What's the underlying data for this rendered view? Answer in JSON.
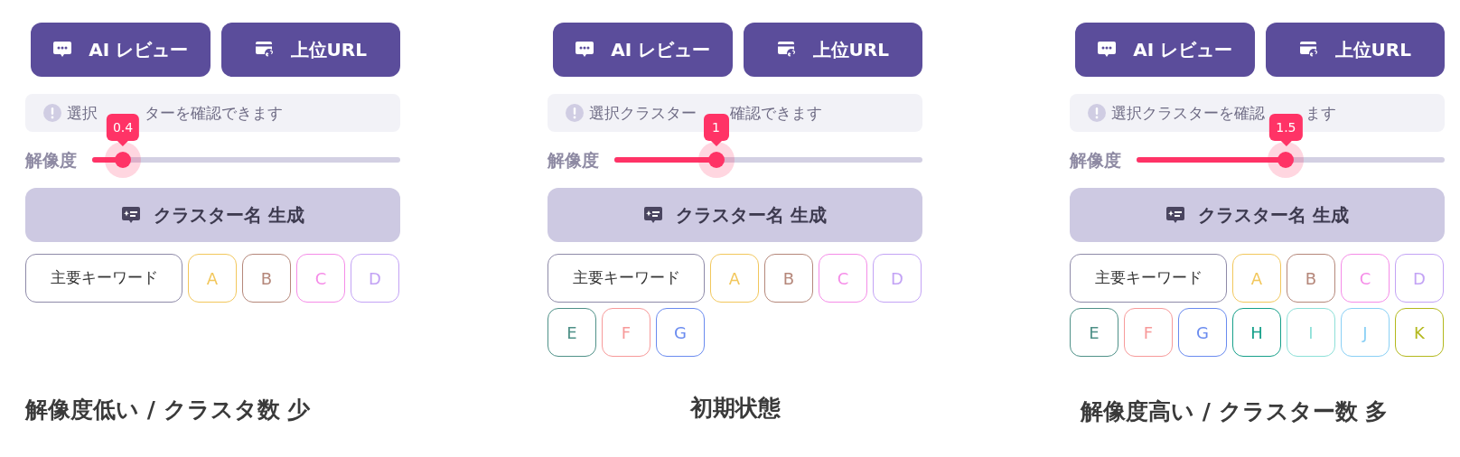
{
  "panels": [
    {
      "buttons": [
        "AI レビュー",
        "上位URL"
      ],
      "hint": [
        "選択",
        "ターを確認できます"
      ],
      "slider": {
        "label": "解像度",
        "value": "0.4",
        "level": 0.1
      },
      "generate_button": "クラスター名 生成",
      "keyword_chip": "主要キーワード",
      "clusters": [
        {
          "label": "A",
          "color": "#f2c75c"
        },
        {
          "label": "B",
          "color": "#b5877a"
        },
        {
          "label": "C",
          "color": "#f58ce8"
        },
        {
          "label": "D",
          "color": "#c3a3f5"
        }
      ],
      "caption": "解像度低い / クラスタ数 少"
    },
    {
      "buttons": [
        "AI レビュー",
        "上位URL"
      ],
      "hint": [
        "選択クラスター",
        "確認できます"
      ],
      "slider": {
        "label": "解像度",
        "value": "1",
        "level": 0.33
      },
      "generate_button": "クラスター名 生成",
      "keyword_chip": "主要キーワード",
      "clusters": [
        {
          "label": "A",
          "color": "#f2c75c"
        },
        {
          "label": "B",
          "color": "#b5877a"
        },
        {
          "label": "C",
          "color": "#f58ce8"
        },
        {
          "label": "D",
          "color": "#c3a3f5"
        },
        {
          "label": "E",
          "color": "#4f9188"
        },
        {
          "label": "F",
          "color": "#f79a9a"
        },
        {
          "label": "G",
          "color": "#6a8bef"
        }
      ],
      "caption": "初期状態"
    },
    {
      "buttons": [
        "AI レビュー",
        "上位URL"
      ],
      "hint": [
        "選択クラスターを確認",
        "ます"
      ],
      "slider": {
        "label": "解像度",
        "value": "1.5",
        "level": 0.485
      },
      "generate_button": "クラスター名 生成",
      "keyword_chip": "主要キーワード",
      "clusters": [
        {
          "label": "A",
          "color": "#f2c75c"
        },
        {
          "label": "B",
          "color": "#b5877a"
        },
        {
          "label": "C",
          "color": "#f58ce8"
        },
        {
          "label": "D",
          "color": "#c3a3f5"
        },
        {
          "label": "E",
          "color": "#4f9188"
        },
        {
          "label": "F",
          "color": "#f79a9a"
        },
        {
          "label": "G",
          "color": "#6a8bef"
        },
        {
          "label": "H",
          "color": "#16a08a"
        },
        {
          "label": "I",
          "color": "#8de0d8"
        },
        {
          "label": "J",
          "color": "#8ad0f5"
        },
        {
          "label": "K",
          "color": "#b3b81c"
        }
      ],
      "caption": "解像度高い / クラスター数 多"
    }
  ]
}
